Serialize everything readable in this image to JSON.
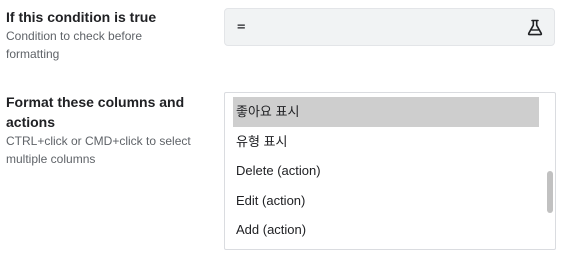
{
  "condition": {
    "title": "If this condition is true",
    "description": "Condition to check before formatting",
    "value": "=",
    "icon": "flask-icon"
  },
  "columns": {
    "title": "Format these columns and actions",
    "description": "CTRL+click or CMD+click to select multiple columns",
    "options": [
      {
        "label": "좋아요 표시",
        "selected": true
      },
      {
        "label": "유형 표시",
        "selected": false
      },
      {
        "label": "Delete (action)",
        "selected": false
      },
      {
        "label": "Edit (action)",
        "selected": false
      },
      {
        "label": "Add (action)",
        "selected": false
      }
    ]
  },
  "colors": {
    "selected_option_bg": "#cecece",
    "condition_box_bg": "#f1f3f4"
  }
}
